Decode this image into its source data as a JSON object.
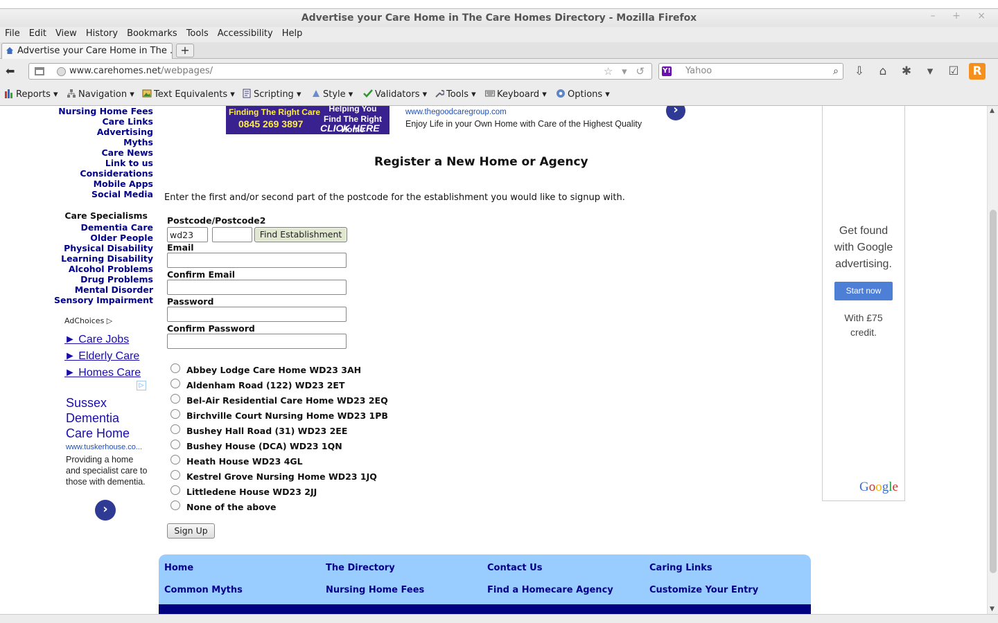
{
  "window": {
    "title": "Advertise your Care Home in The Care Homes Directory - Mozilla Firefox",
    "controls": "– + ×"
  },
  "menubar": [
    "File",
    "Edit",
    "View",
    "History",
    "Bookmarks",
    "Tools",
    "Accessibility",
    "Help"
  ],
  "tab": {
    "label": "Advertise your Care Home in The ...",
    "new_tab": "+"
  },
  "navbar": {
    "back": "⬅",
    "url_host": "www.carehomes.net",
    "url_path": "/webpages/",
    "url_icons": "☆ ▾ ↺",
    "search_engine": "Y!",
    "search_placeholder": "Yahoo",
    "search_icon": "🔍",
    "icons": [
      "download-icon",
      "home-icon",
      "addon-icon",
      "dropdown-icon",
      "validator-icon",
      "rss-icon",
      "menu-dropdown-icon"
    ]
  },
  "toolbar": {
    "items": [
      {
        "label": "Reports ▾",
        "icon": "reports-icon"
      },
      {
        "label": "Navigation ▾",
        "icon": "navigation-icon"
      },
      {
        "label": "Text Equivalents ▾",
        "icon": "image-icon"
      },
      {
        "label": "Scripting ▾",
        "icon": "script-icon"
      },
      {
        "label": "Style ▾",
        "icon": "style-icon"
      },
      {
        "label": "Validators ▾",
        "icon": "check-icon"
      },
      {
        "label": "Tools ▾",
        "icon": "wrench-icon"
      },
      {
        "label": "Keyboard ▾",
        "icon": "keyboard-icon"
      },
      {
        "label": "Options ▾",
        "icon": "options-icon"
      }
    ]
  },
  "leftnav": {
    "links": [
      "Nursing Home Fees",
      "Care Links",
      "Advertising",
      "Myths",
      "Care News",
      "Link to us",
      "Considerations",
      "Mobile Apps",
      "Social Media"
    ],
    "specialisms_heading": "Care Specialisms",
    "specialisms": [
      "Dementia Care",
      "Older People",
      "Physical Disability",
      "Learning Disability",
      "Alcohol Problems",
      "Drug Problems",
      "Mental Disorder",
      "Sensory Impairment"
    ]
  },
  "left_ads": {
    "adchoices": "AdChoices ▷",
    "links": [
      "► Care Jobs",
      "► Elderly Care",
      "► Homes Care"
    ],
    "badge": "▷",
    "sussex_title": "Sussex Dementia Care Home",
    "sussex_url": "www.tuskerhouse.co...",
    "sussex_desc": "Providing a home and specialist care to those with dementia.",
    "arrow": "›"
  },
  "top_ad": {
    "banner_line1": "Finding The Right Care",
    "banner_phone": "0845 269 3897",
    "banner_line2": "Helping You Find The Right Home",
    "banner_cta": "CLICK HERE",
    "url": "www.thegoodcaregroup.com",
    "description": "Enjoy Life in your Own Home with Care of the Highest Quality",
    "arrow": "›"
  },
  "form": {
    "title": "Register a New Home or Agency",
    "intro": "Enter the first and/or second part of the postcode for the establishment you would like to signup with.",
    "postcode_label": "Postcode/Postcode2",
    "postcode1_value": "wd23",
    "postcode2_value": "",
    "find_button": "Find Establishment",
    "email_label": "Email",
    "confirm_email_label": "Confirm Email",
    "password_label": "Password",
    "confirm_password_label": "Confirm Password",
    "establishments": [
      "Abbey Lodge Care Home WD23 3AH",
      "Aldenham Road (122) WD23 2ET",
      "Bel-Air Residential Care Home WD23 2EQ",
      "Birchville Court Nursing Home WD23 1PB",
      "Bushey Hall Road (31) WD23 2EE",
      "Bushey House (DCA) WD23 1QN",
      "Heath House WD23 4GL",
      "Kestrel Grove Nursing Home WD23 1JQ",
      "Littledene House WD23 2JJ",
      "None of the above"
    ],
    "signup_button": "Sign Up"
  },
  "right_ad": {
    "headline": "Get found with Google advertising.",
    "button": "Start now",
    "sub": "With £75 credit.",
    "logo": "Google",
    "logo_colors": [
      "#3b6fd4",
      "#d62d20",
      "#f3b400",
      "#3b6fd4",
      "#1b9c3c",
      "#d62d20"
    ]
  },
  "footer": {
    "links": [
      "Home",
      "The Directory",
      "Contact Us",
      "Caring Links",
      "Common Myths",
      "Nursing Home Fees",
      "Find a Homecare Agency",
      "Customize Your Entry"
    ]
  },
  "colors": {
    "nav_link": "#00008b",
    "footer_bg": "#99ccff",
    "footer_bar": "#000080",
    "ad_link": "#1a0dab"
  }
}
